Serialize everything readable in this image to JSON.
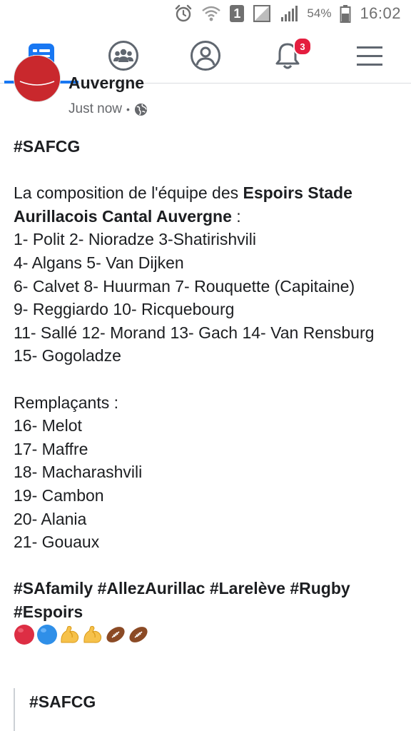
{
  "status_bar": {
    "sim_label": "1",
    "battery_percent": "54%",
    "time": "16:02"
  },
  "nav": {
    "items": [
      {
        "name": "news-feed",
        "icon": "news-feed-icon",
        "active": true
      },
      {
        "name": "groups",
        "icon": "groups-icon",
        "active": false
      },
      {
        "name": "profile",
        "icon": "profile-icon",
        "active": false
      },
      {
        "name": "notifications",
        "icon": "bell-icon",
        "active": false,
        "badge": "3"
      },
      {
        "name": "menu",
        "icon": "hamburger-menu-icon",
        "active": false
      }
    ],
    "accent_color": "#1877f2",
    "badge_color": "#e41e3f"
  },
  "post": {
    "page_name": "Auvergne",
    "timestamp": "Just now",
    "separator": "•",
    "privacy_icon": "globe-icon",
    "hashtag_top": "#SAFCG",
    "intro_prefix": "La composition de l'équipe des ",
    "intro_team": "Espoirs Stade Aurillacois Cantal Auvergne",
    "intro_suffix": " :",
    "lineup": [
      "1- Polit  2- Nioradze 3-Shatirishvili",
      "4- Algans 5- Van Dijken",
      "6- Calvet 8- Huurman 7- Rouquette (Capitaine)",
      "9- Reggiardo 10- Ricquebourg",
      "11- Sallé 12- Morand 13- Gach 14- Van Rensburg",
      "15- Gogoladze"
    ],
    "subs_title": "Remplaçants :",
    "subs": [
      "16- Melot",
      "17- Maffre",
      "18- Macharashvili",
      "19- Cambon",
      "20- Alania",
      "21- Gouaux"
    ],
    "hashtags_bottom": "#SAfamily #AllezAurillac #Larelève #Rugby #Espoirs",
    "emojis": [
      "red-circle",
      "blue-circle",
      "flexed-biceps",
      "flexed-biceps",
      "american-football",
      "american-football"
    ],
    "quoted_text": "#SAFCG"
  }
}
